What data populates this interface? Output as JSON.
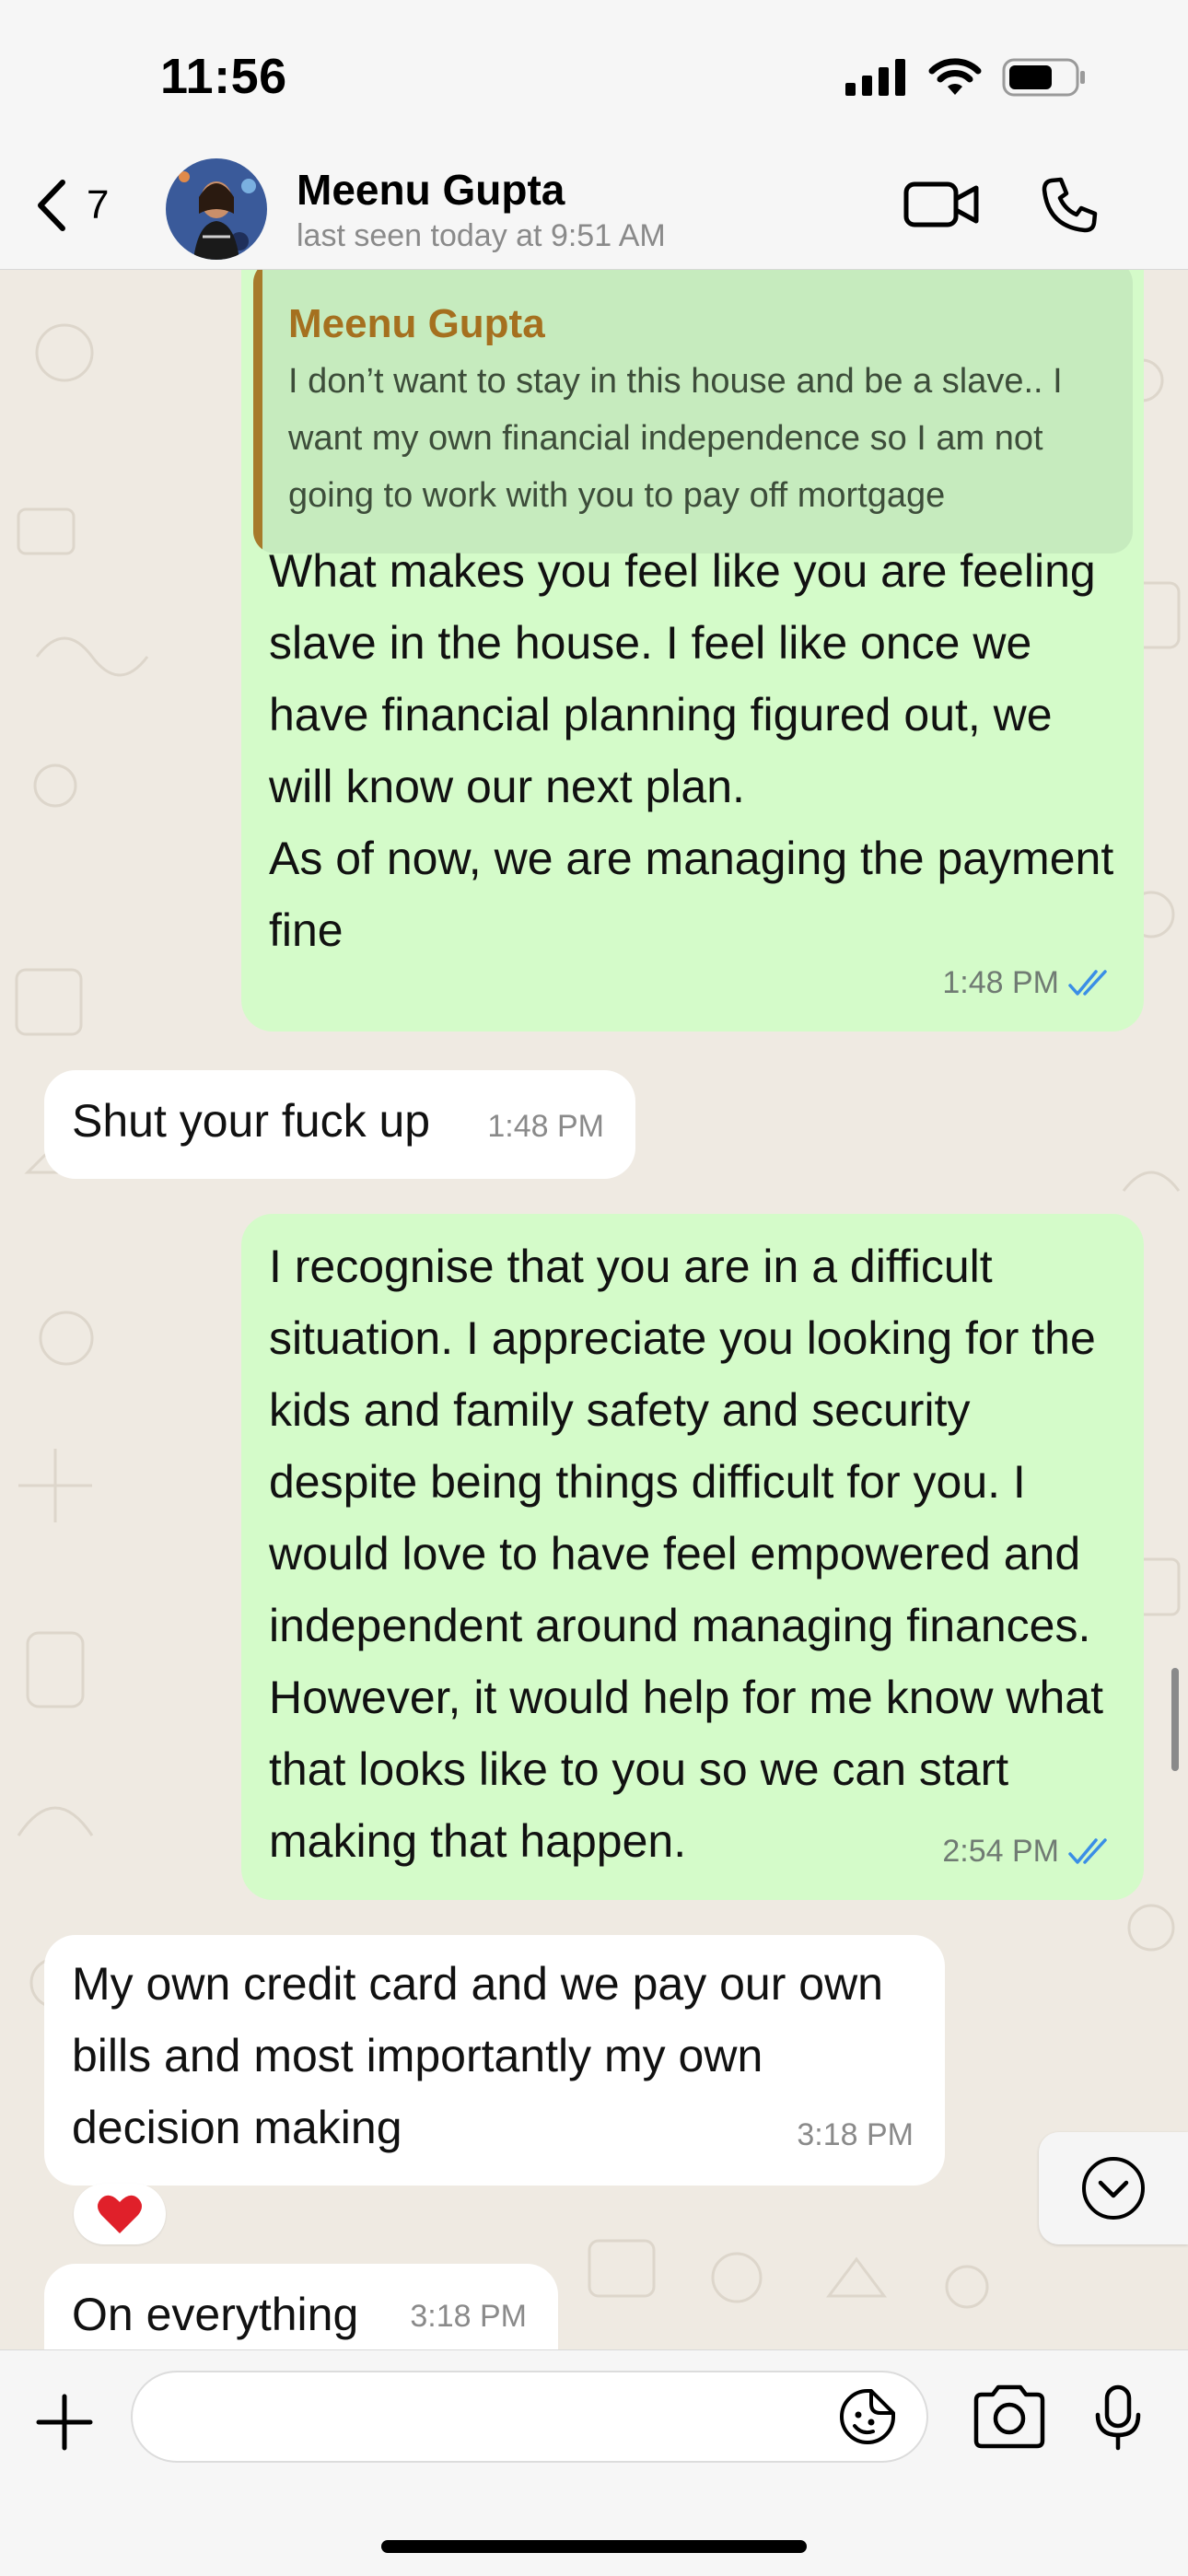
{
  "status_bar": {
    "time": "11:56"
  },
  "header": {
    "back_count": "7",
    "contact_name": "Meenu Gupta",
    "last_seen": "last seen today at 9:51 AM"
  },
  "messages": [
    {
      "direction": "outgoing",
      "quote": {
        "author": "Meenu Gupta",
        "text": "I don’t want to stay in this house and be a slave.. I want my own financial independence so I am not going to work with you to pay off mortgage"
      },
      "text": "What makes you feel like you are feeling slave in the house. I feel like once we have financial planning figured out, we will know our next plan.\nAs of now, we are managing the payment fine",
      "time": "1:48 PM",
      "status": "read"
    },
    {
      "direction": "incoming",
      "text": "Shut your fuck up",
      "time": "1:48 PM"
    },
    {
      "direction": "outgoing",
      "text": "I recognise that you are in a difficult situation. I appreciate you looking for the kids and family safety and security despite being things difficult for you. I would love to have feel empowered and independent around managing finances. However, it would help for me know what that looks like to you so we can start making that happen.",
      "time": "2:54 PM",
      "status": "read"
    },
    {
      "direction": "incoming",
      "text": "My own credit card and we pay our own bills and most importantly my own decision making",
      "time": "3:18 PM",
      "reaction": "❤️"
    },
    {
      "direction": "incoming",
      "text": "On everything",
      "time": "3:18 PM"
    }
  ],
  "composer": {
    "placeholder": ""
  },
  "colors": {
    "outgoing_bubble": "#d4fbc9",
    "incoming_bubble": "#ffffff",
    "read_ticks": "#3a8ee6",
    "quote_accent": "#a77a2b",
    "chat_background": "#efeae2"
  },
  "icons": [
    "back-chevron-icon",
    "video-call-icon",
    "phone-icon",
    "signal-icon",
    "wifi-icon",
    "battery-icon",
    "double-check-icon",
    "heart-icon",
    "chevron-down-icon",
    "plus-icon",
    "sticker-icon",
    "camera-icon",
    "microphone-icon"
  ]
}
